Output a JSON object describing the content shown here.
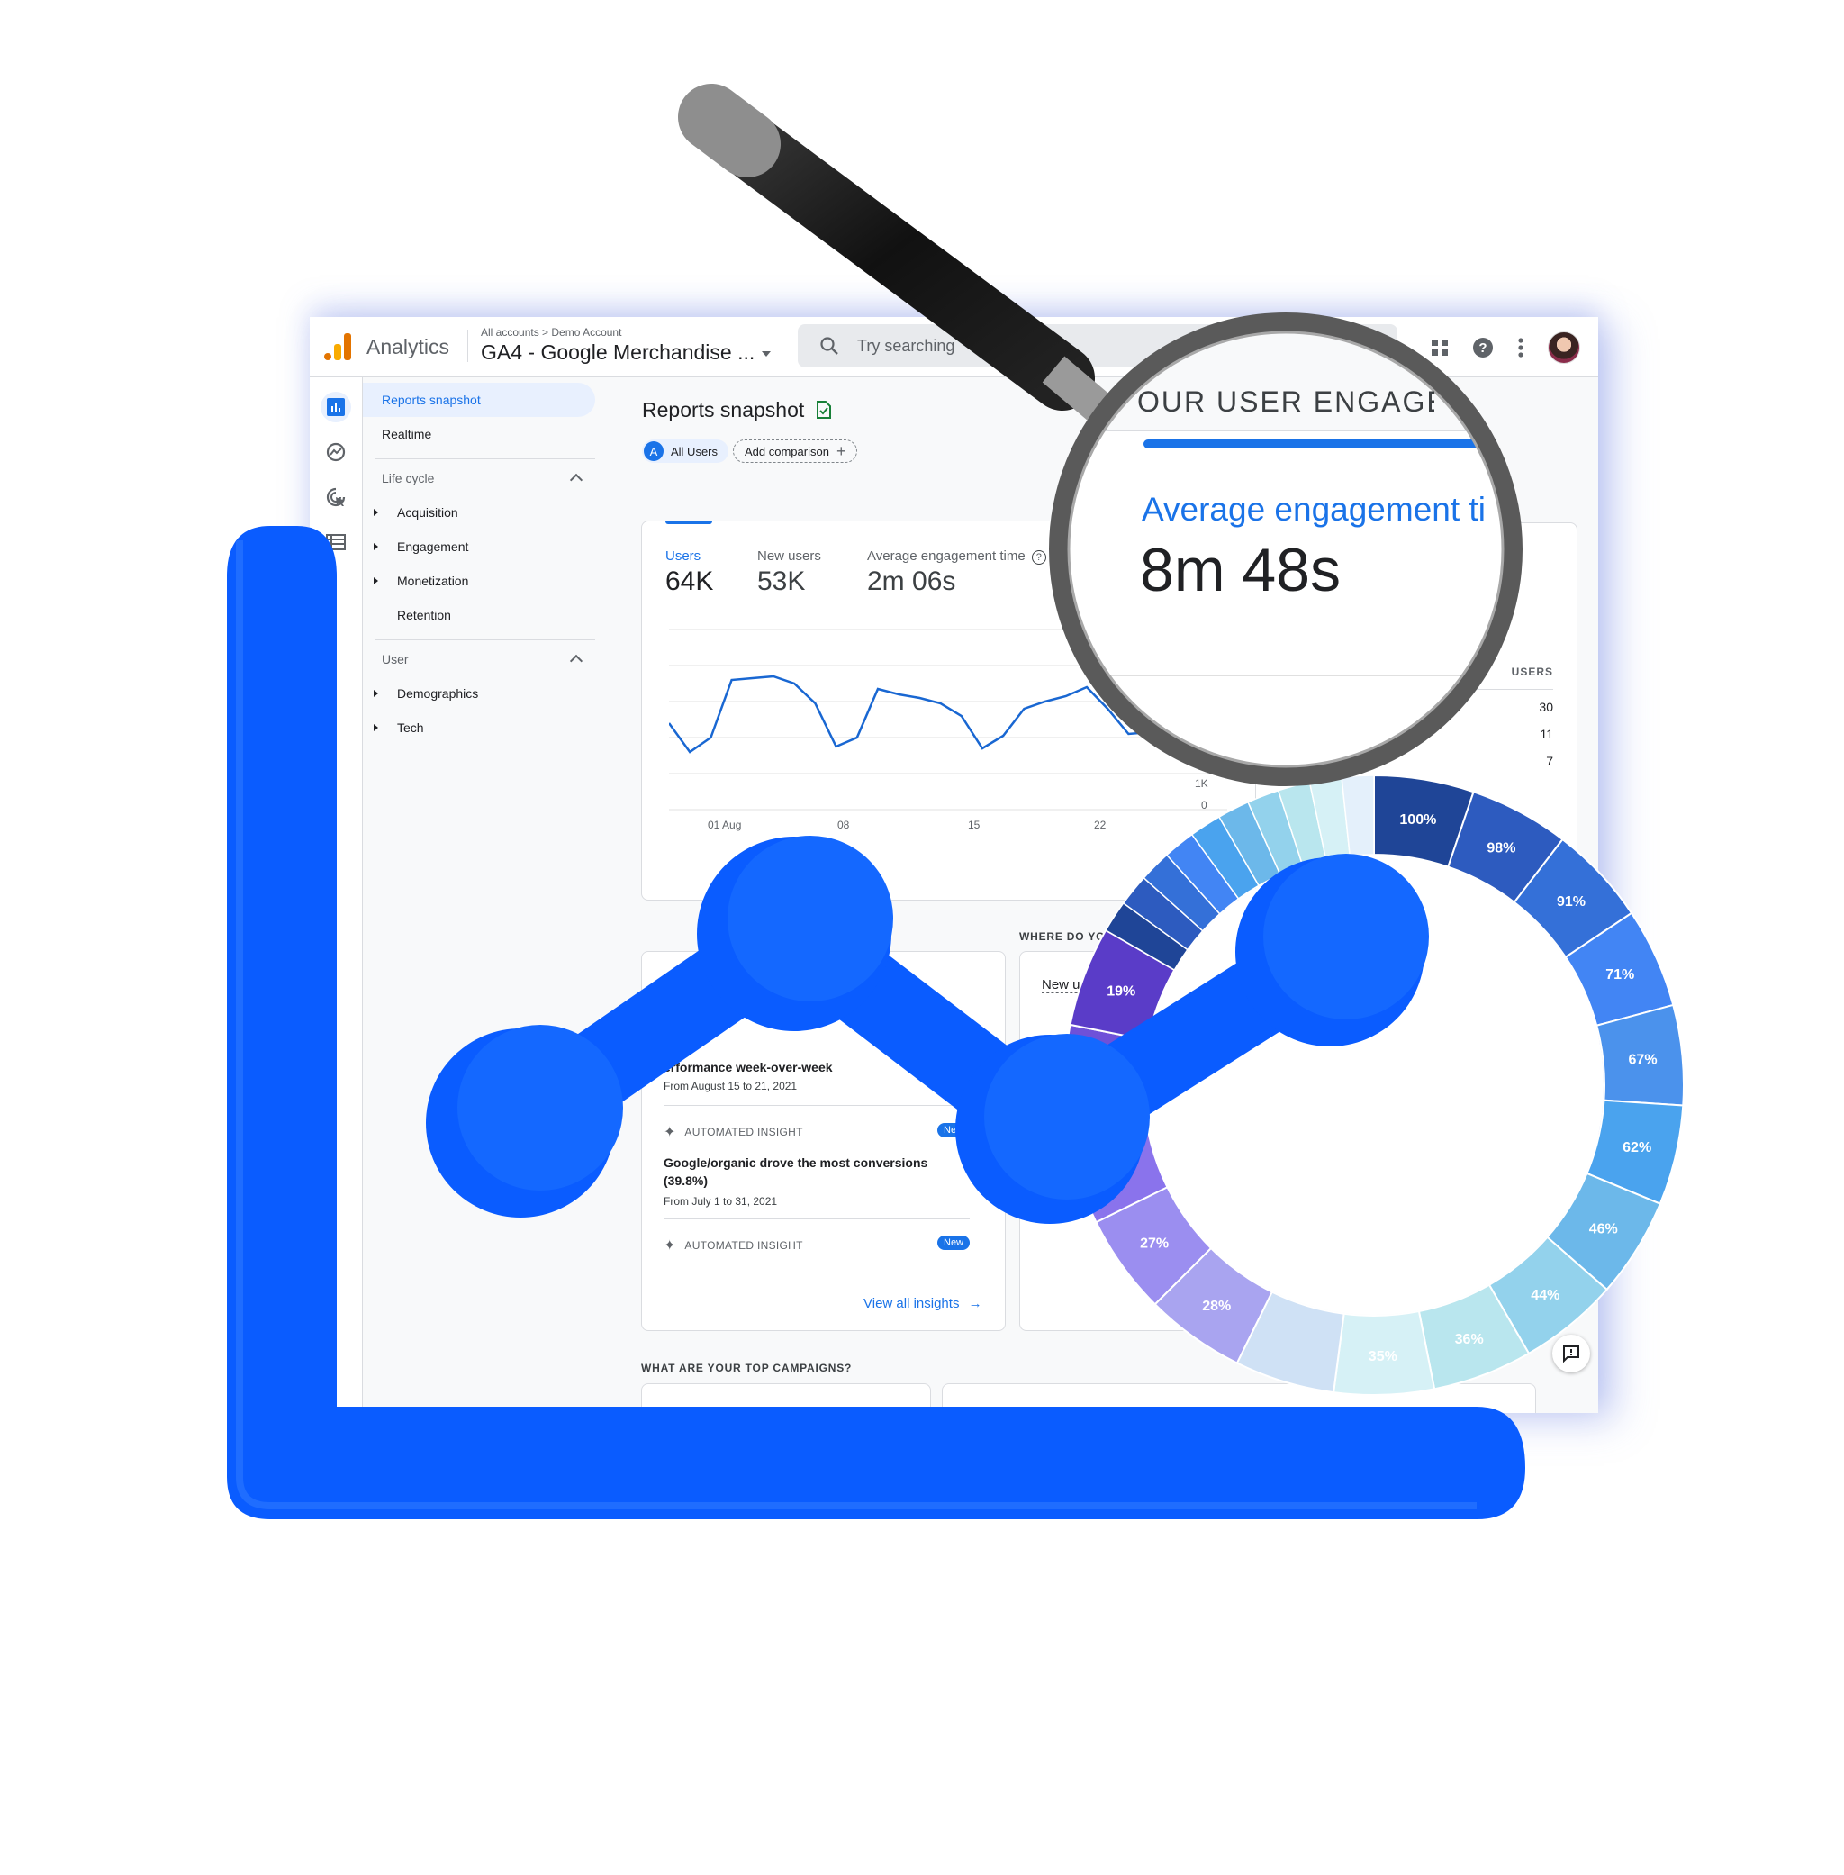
{
  "app": {
    "product_name": "Analytics",
    "breadcrumb": [
      "All accounts",
      "Demo Account"
    ],
    "property_name": "GA4 - Google Merchandise ...",
    "search_placeholder": "Try searching"
  },
  "nav": {
    "items": [
      {
        "label": "Reports snapshot",
        "active": true
      },
      {
        "label": "Realtime"
      }
    ],
    "sections": [
      {
        "label": "Life cycle",
        "items": [
          {
            "label": "Acquisition",
            "expandable": true
          },
          {
            "label": "Engagement",
            "expandable": true
          },
          {
            "label": "Monetization",
            "expandable": true
          },
          {
            "label": "Retention",
            "expandable": false
          }
        ]
      },
      {
        "label": "User",
        "items": [
          {
            "label": "Demographics",
            "expandable": true
          },
          {
            "label": "Tech",
            "expandable": true
          }
        ]
      }
    ]
  },
  "main": {
    "title": "Reports snapshot",
    "segment_chip": {
      "letter": "A",
      "label": "All Users"
    },
    "add_comparison_label": "Add comparison",
    "metrics": [
      {
        "label": "Users",
        "value": "64K",
        "active": true
      },
      {
        "label": "New users",
        "value": "53K"
      },
      {
        "label": "Average engagement time",
        "value": "2m 06s"
      }
    ],
    "realtime_axis": [
      "1K",
      "0"
    ],
    "right_table": {
      "header": "USERS",
      "values": [
        "30",
        "11",
        "7"
      ]
    },
    "where_heading": "WHERE DO YOU",
    "where_card_label": "New us",
    "insights": {
      "first_title": "erformance week-over-week",
      "first_date": "From August 15 to 21, 2021",
      "items": [
        {
          "label": "AUTOMATED INSIGHT",
          "badge": "New",
          "title": "Google/organic drove the most conversions (39.8%)",
          "date": "From July 1 to 31, 2021"
        },
        {
          "label": "AUTOMATED INSIGHT",
          "badge": "New"
        }
      ],
      "view_all_label": "View all insights"
    },
    "campaigns_heading": "WHAT ARE YOUR TOP CAMPAIGNS?"
  },
  "magnifier": {
    "heading": "OUR USER ENGAGEME",
    "metric_label": "Average engagement ti",
    "metric_value": "8m 48s"
  },
  "colors": {
    "brand_blue": "#1a73e8",
    "decor_blue": "#0a5cff",
    "ga_orange": "#f9ab00",
    "ga_orange_dark": "#e37400"
  },
  "chart_data": [
    {
      "type": "line",
      "title": "Users",
      "x": [
        "Jul 29",
        "Jul 30",
        "Jul 31",
        "Aug 01",
        "Aug 02",
        "Aug 03",
        "Aug 04",
        "Aug 05",
        "Aug 06",
        "Aug 07",
        "Aug 08",
        "Aug 09",
        "Aug 10",
        "Aug 11",
        "Aug 12",
        "Aug 13",
        "Aug 14",
        "Aug 15",
        "Aug 16",
        "Aug 17",
        "Aug 18",
        "Aug 19",
        "Aug 20",
        "Aug 21",
        "Aug 22",
        "Aug 23"
      ],
      "series": [
        {
          "name": "Users",
          "values": [
            2.4,
            1.6,
            2.0,
            3.6,
            3.65,
            3.7,
            3.5,
            2.95,
            1.75,
            2.0,
            3.35,
            3.2,
            3.1,
            2.95,
            2.6,
            1.7,
            2.05,
            2.8,
            3.0,
            3.15,
            3.4,
            2.8,
            2.1,
            2.15,
            2.8
          ]
        }
      ],
      "x_ticks": [
        "01 Aug",
        "08",
        "15",
        "22"
      ],
      "ylim": [
        0,
        5
      ],
      "grid": true
    },
    {
      "type": "pie",
      "title": "",
      "values": [
        100,
        98,
        91,
        71,
        67,
        62,
        46,
        44,
        36,
        35,
        35,
        28,
        27,
        27,
        19,
        19
      ],
      "labels": [
        "100%",
        "98%",
        "91%",
        "71%",
        "67%",
        "62%",
        "46%",
        "44%",
        "36%",
        "35%",
        "",
        "28%",
        "27%",
        "27%",
        "19%",
        "19%"
      ],
      "donut": true
    }
  ]
}
